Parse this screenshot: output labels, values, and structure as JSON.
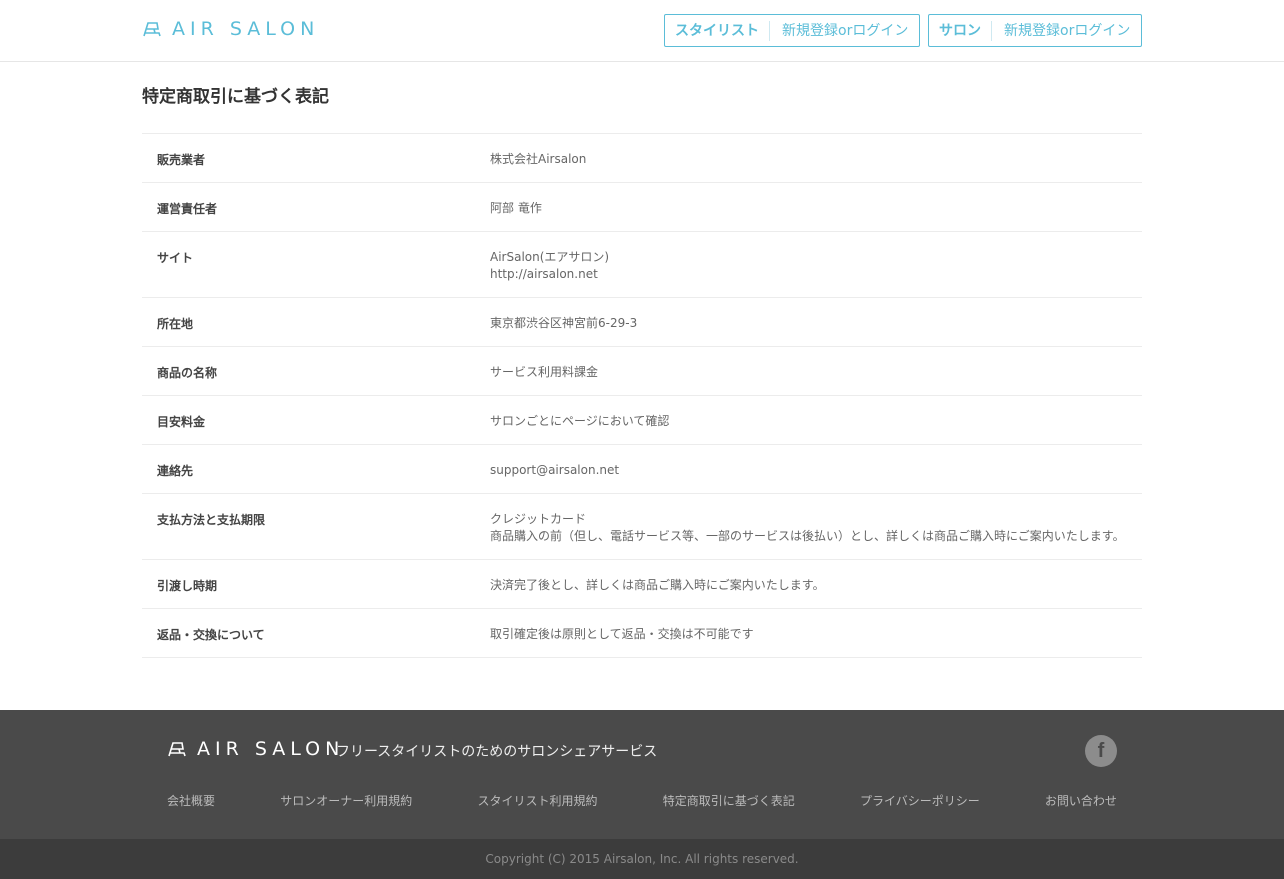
{
  "header": {
    "logo_text": "AIR SALON",
    "stylist": {
      "role": "スタイリスト",
      "action": "新規登録orログイン"
    },
    "salon": {
      "role": "サロン",
      "action": "新規登録orログイン"
    }
  },
  "page_title": "特定商取引に基づく表記",
  "rows": [
    {
      "label": "販売業者",
      "lines": [
        "株式会社Airsalon"
      ]
    },
    {
      "label": "運営責任者",
      "lines": [
        "阿部 竜作"
      ]
    },
    {
      "label": "サイト",
      "lines": [
        "AirSalon(エアサロン)",
        "http://airsalon.net"
      ]
    },
    {
      "label": "所在地",
      "lines": [
        "東京都渋谷区神宮前6-29-3"
      ]
    },
    {
      "label": "商品の名称",
      "lines": [
        "サービス利用料課金"
      ]
    },
    {
      "label": "目安料金",
      "lines": [
        "サロンごとにページにおいて確認"
      ]
    },
    {
      "label": "連絡先",
      "lines": [
        "support@airsalon.net"
      ]
    },
    {
      "label": "支払方法と支払期限",
      "lines": [
        "クレジットカード",
        "商品購入の前（但し、電話サービス等、一部のサービスは後払い）とし、詳しくは商品ご購入時にご案内いたします。"
      ]
    },
    {
      "label": "引渡し時期",
      "lines": [
        "決済完了後とし、詳しくは商品ご購入時にご案内いたします。"
      ]
    },
    {
      "label": "返品・交換について",
      "lines": [
        "取引確定後は原則として返品・交換は不可能です"
      ]
    }
  ],
  "footer": {
    "logo_text": "AIR SALON",
    "tagline": "フリースタイリストのためのサロンシェアサービス",
    "facebook_icon": "f",
    "links": [
      "会社概要",
      "サロンオーナー利用規約",
      "スタイリスト利用規約",
      "特定商取引に基づく表記",
      "プライバシーポリシー",
      "お問い合わせ"
    ],
    "copyright": "Copyright (C) 2015 Airsalon, Inc. All rights reserved."
  },
  "colors": {
    "accent": "#5bbdd8",
    "footer_bg": "#4a4a4a",
    "copyright_bg": "#3c3c3c"
  }
}
